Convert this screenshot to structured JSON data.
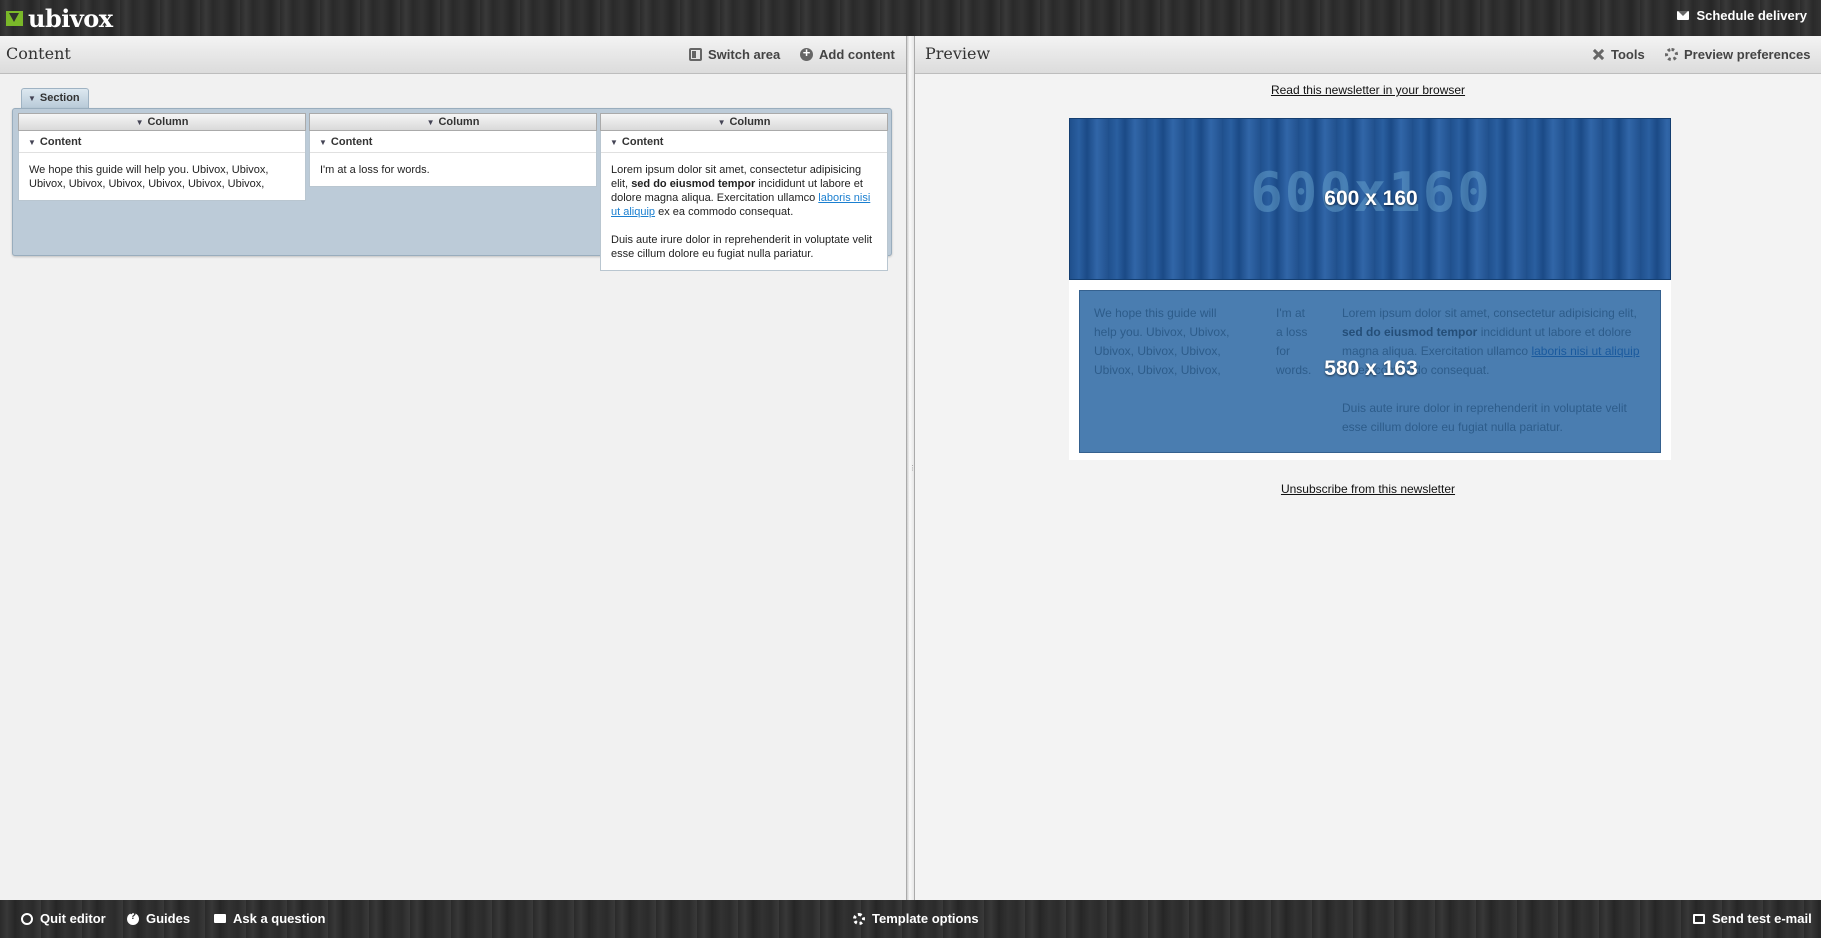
{
  "app": {
    "logo_text": "ubivox"
  },
  "topbar": {
    "schedule_label": "Schedule delivery"
  },
  "content_panel": {
    "title": "Content",
    "switch_area_label": "Switch area",
    "add_content_label": "Add content",
    "section_label": "Section",
    "columns": [
      {
        "header": "Column",
        "block_label": "Content",
        "text": "We hope this guide will help you. Ubivox, Ubivox, Ubivox, Ubivox, Ubivox, Ubivox, Ubivox, Ubivox,"
      },
      {
        "header": "Column",
        "block_label": "Content",
        "text": "I'm at a loss for words."
      },
      {
        "header": "Column",
        "block_label": "Content",
        "p1_a": "Lorem ipsum dolor sit amet, consectetur adipisicing elit,",
        "p1_bold": "sed do eiusmod tempor",
        "p1_b": "incididunt ut labore et dolore magna aliqua. Exercitation ullamco",
        "p1_link": "laboris nisi ut aliquip",
        "p1_c": "ex ea commodo consequat.",
        "p2": "Duis aute irure dolor in reprehenderit in voluptate velit esse cillum dolore eu fugiat nulla pariatur."
      }
    ]
  },
  "preview_panel": {
    "title": "Preview",
    "tools_label": "Tools",
    "prefs_label": "Preview preferences",
    "read_link": "Read this newsletter in your browser",
    "banner_bg_text": "600x160",
    "banner_label": "600 x 160",
    "body_label": "580 x 163",
    "col1_text": "We hope this guide will help you. Ubivox, Ubivox, Ubivox, Ubivox, Ubivox, Ubivox, Ubivox, Ubivox,",
    "col2_text": "I'm at a loss for words.",
    "col3_p1_a": "Lorem ipsum dolor sit amet, consectetur adipisicing elit,",
    "col3_p1_bold": "sed do eiusmod tempor",
    "col3_p1_b": "incididunt ut labore et dolore magna aliqua. Exercitation ullamco",
    "col3_p1_link": "laboris nisi ut aliquip",
    "col3_p1_c": "ex ea commodo consequat.",
    "col3_p2": "Duis aute irure dolor in reprehenderit in voluptate velit esse cillum dolore eu fugiat nulla pariatur.",
    "unsubscribe": "Unsubscribe from this newsletter"
  },
  "bottombar": {
    "quit_label": "Quit editor",
    "guides_label": "Guides",
    "ask_label": "Ask a question",
    "template_label": "Template options",
    "send_test_label": "Send test e-mail"
  },
  "colors": {
    "brand_green": "#7ab829",
    "section_blue": "#bccbd8",
    "preview_block_blue": "#4a7db0",
    "link_blue": "#1a7fd0"
  }
}
